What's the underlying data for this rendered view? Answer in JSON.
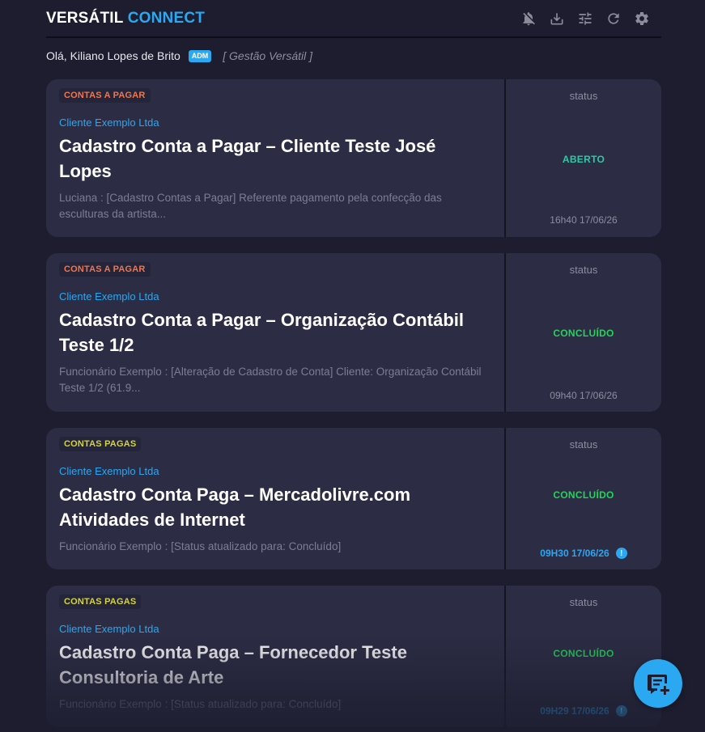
{
  "brand": {
    "part1": "VERSÁTIL",
    "part2": "CONNECT"
  },
  "toolbar": {
    "icons": [
      "notifications-off-icon",
      "download-icon",
      "tune-icon",
      "refresh-icon",
      "settings-icon"
    ]
  },
  "greeting": {
    "text": "Olá, Kiliano Lopes de Brito",
    "role_badge": "ADM",
    "company": "[ Gestão Versátil ]"
  },
  "cards": [
    {
      "category": "CONTAS A PAGAR",
      "client": "Cliente Exemplo Ltda",
      "title": "Cadastro Conta a Pagar – Cliente Teste José Lopes",
      "description": "Luciana : [Cadastro Contas a Pagar] Referente pagamento pela confecção das esculturas da artista...",
      "status_label": "status",
      "status": "ABERTO",
      "time": "16h40 17/06/26"
    },
    {
      "category": "CONTAS A PAGAR",
      "client": "Cliente Exemplo Ltda",
      "title": "Cadastro Conta a Pagar – Organização Contábil Teste 1/2",
      "description": "Funcionário Exemplo : [Alteração de Cadastro de Conta] Cliente: Organização Contábil Teste 1/2 (61.9...",
      "status_label": "status",
      "status": "CONCLUÍDO",
      "time": "09h40 17/06/26"
    },
    {
      "category": "CONTAS PAGAS",
      "client": "Cliente Exemplo Ltda",
      "title": "Cadastro Conta Paga – Mercadolivre.com Atividades de Internet",
      "description": "Funcionário Exemplo : [Status atualizado para: Concluído]",
      "status_label": "status",
      "status": "CONCLUÍDO",
      "time": "09H30 17/06/26",
      "alert": "!"
    },
    {
      "category": "CONTAS PAGAS",
      "client": "Cliente Exemplo Ltda",
      "title": "Cadastro Conta Paga – Fornecedor Teste Consultoria de Arte",
      "description": "Funcionário Exemplo : [Status atualizado para: Concluído]",
      "status_label": "status",
      "status": "CONCLUÍDO",
      "time": "09H29 17/06/26",
      "alert": "!"
    }
  ],
  "colors": {
    "accent": "#2aa8f2",
    "background": "#1d1d2f",
    "card": "#2c2c45",
    "aberto": "#2fc9a4",
    "concluido": "#25d35a",
    "pagar": "#f0764f",
    "pagas": "#d6d43a"
  },
  "fab": {
    "icon": "new-note-icon"
  }
}
